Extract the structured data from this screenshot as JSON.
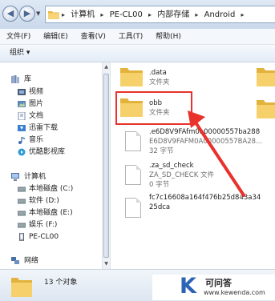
{
  "address_bar": {
    "crumbs": [
      "计算机",
      "PE-CL00",
      "内部存储",
      "Android"
    ],
    "separator": "▸"
  },
  "menu": [
    "文件(F)",
    "编辑(E)",
    "查看(V)",
    "工具(T)",
    "帮助(H)"
  ],
  "toolbar": {
    "organize_label": "组织 ▾"
  },
  "nav_pane": {
    "libraries": {
      "label": "库",
      "items": [
        "视频",
        "图片",
        "文档",
        "迅雷下载",
        "音乐",
        "优酷影视库"
      ]
    },
    "computer": {
      "label": "计算机",
      "items": [
        "本地磁盘 (C:)",
        "软件 (D:)",
        "本地磁盘 (E:)",
        "娱乐 (F:)",
        "PE-CL00"
      ]
    },
    "network": {
      "label": "网络"
    }
  },
  "files": [
    {
      "name": ".data",
      "meta": "文件夹",
      "type": "folder"
    },
    {
      "name": "obb",
      "meta": "文件夹",
      "type": "folder"
    },
    {
      "name": ".e6D8V9FAfm0a00000557ba288",
      "name2": "E6D8V9FAFM0A00000557BA28...",
      "meta": "32 字节",
      "type": "file"
    },
    {
      "name": ".za_sd_check",
      "name2": "ZA_SD_CHECK 文件",
      "meta": "0 字节",
      "type": "file"
    },
    {
      "name": "fc7c16608a164f476b25d843a34",
      "name2": "25dca",
      "type": "file"
    }
  ],
  "status": {
    "text": "13 个对象"
  },
  "watermark": {
    "logo_letter": "K",
    "title": "可问答",
    "url": "www.kewenda.com"
  },
  "colors": {
    "highlight": "#e8322b",
    "folder": "#f2c94c",
    "watermark_blue": "#2d63b5"
  }
}
